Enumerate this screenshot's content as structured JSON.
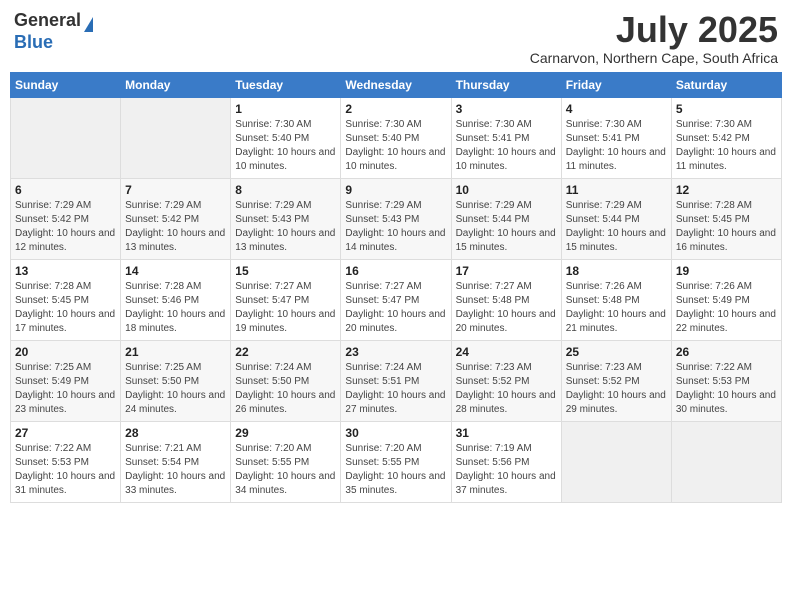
{
  "logo": {
    "general": "General",
    "blue": "Blue"
  },
  "title": "July 2025",
  "subtitle": "Carnarvon, Northern Cape, South Africa",
  "days_of_week": [
    "Sunday",
    "Monday",
    "Tuesday",
    "Wednesday",
    "Thursday",
    "Friday",
    "Saturday"
  ],
  "weeks": [
    [
      {
        "day": "",
        "sunrise": "",
        "sunset": "",
        "daylight": ""
      },
      {
        "day": "",
        "sunrise": "",
        "sunset": "",
        "daylight": ""
      },
      {
        "day": "1",
        "sunrise": "Sunrise: 7:30 AM",
        "sunset": "Sunset: 5:40 PM",
        "daylight": "Daylight: 10 hours and 10 minutes."
      },
      {
        "day": "2",
        "sunrise": "Sunrise: 7:30 AM",
        "sunset": "Sunset: 5:40 PM",
        "daylight": "Daylight: 10 hours and 10 minutes."
      },
      {
        "day": "3",
        "sunrise": "Sunrise: 7:30 AM",
        "sunset": "Sunset: 5:41 PM",
        "daylight": "Daylight: 10 hours and 10 minutes."
      },
      {
        "day": "4",
        "sunrise": "Sunrise: 7:30 AM",
        "sunset": "Sunset: 5:41 PM",
        "daylight": "Daylight: 10 hours and 11 minutes."
      },
      {
        "day": "5",
        "sunrise": "Sunrise: 7:30 AM",
        "sunset": "Sunset: 5:42 PM",
        "daylight": "Daylight: 10 hours and 11 minutes."
      }
    ],
    [
      {
        "day": "6",
        "sunrise": "Sunrise: 7:29 AM",
        "sunset": "Sunset: 5:42 PM",
        "daylight": "Daylight: 10 hours and 12 minutes."
      },
      {
        "day": "7",
        "sunrise": "Sunrise: 7:29 AM",
        "sunset": "Sunset: 5:42 PM",
        "daylight": "Daylight: 10 hours and 13 minutes."
      },
      {
        "day": "8",
        "sunrise": "Sunrise: 7:29 AM",
        "sunset": "Sunset: 5:43 PM",
        "daylight": "Daylight: 10 hours and 13 minutes."
      },
      {
        "day": "9",
        "sunrise": "Sunrise: 7:29 AM",
        "sunset": "Sunset: 5:43 PM",
        "daylight": "Daylight: 10 hours and 14 minutes."
      },
      {
        "day": "10",
        "sunrise": "Sunrise: 7:29 AM",
        "sunset": "Sunset: 5:44 PM",
        "daylight": "Daylight: 10 hours and 15 minutes."
      },
      {
        "day": "11",
        "sunrise": "Sunrise: 7:29 AM",
        "sunset": "Sunset: 5:44 PM",
        "daylight": "Daylight: 10 hours and 15 minutes."
      },
      {
        "day": "12",
        "sunrise": "Sunrise: 7:28 AM",
        "sunset": "Sunset: 5:45 PM",
        "daylight": "Daylight: 10 hours and 16 minutes."
      }
    ],
    [
      {
        "day": "13",
        "sunrise": "Sunrise: 7:28 AM",
        "sunset": "Sunset: 5:45 PM",
        "daylight": "Daylight: 10 hours and 17 minutes."
      },
      {
        "day": "14",
        "sunrise": "Sunrise: 7:28 AM",
        "sunset": "Sunset: 5:46 PM",
        "daylight": "Daylight: 10 hours and 18 minutes."
      },
      {
        "day": "15",
        "sunrise": "Sunrise: 7:27 AM",
        "sunset": "Sunset: 5:47 PM",
        "daylight": "Daylight: 10 hours and 19 minutes."
      },
      {
        "day": "16",
        "sunrise": "Sunrise: 7:27 AM",
        "sunset": "Sunset: 5:47 PM",
        "daylight": "Daylight: 10 hours and 20 minutes."
      },
      {
        "day": "17",
        "sunrise": "Sunrise: 7:27 AM",
        "sunset": "Sunset: 5:48 PM",
        "daylight": "Daylight: 10 hours and 20 minutes."
      },
      {
        "day": "18",
        "sunrise": "Sunrise: 7:26 AM",
        "sunset": "Sunset: 5:48 PM",
        "daylight": "Daylight: 10 hours and 21 minutes."
      },
      {
        "day": "19",
        "sunrise": "Sunrise: 7:26 AM",
        "sunset": "Sunset: 5:49 PM",
        "daylight": "Daylight: 10 hours and 22 minutes."
      }
    ],
    [
      {
        "day": "20",
        "sunrise": "Sunrise: 7:25 AM",
        "sunset": "Sunset: 5:49 PM",
        "daylight": "Daylight: 10 hours and 23 minutes."
      },
      {
        "day": "21",
        "sunrise": "Sunrise: 7:25 AM",
        "sunset": "Sunset: 5:50 PM",
        "daylight": "Daylight: 10 hours and 24 minutes."
      },
      {
        "day": "22",
        "sunrise": "Sunrise: 7:24 AM",
        "sunset": "Sunset: 5:50 PM",
        "daylight": "Daylight: 10 hours and 26 minutes."
      },
      {
        "day": "23",
        "sunrise": "Sunrise: 7:24 AM",
        "sunset": "Sunset: 5:51 PM",
        "daylight": "Daylight: 10 hours and 27 minutes."
      },
      {
        "day": "24",
        "sunrise": "Sunrise: 7:23 AM",
        "sunset": "Sunset: 5:52 PM",
        "daylight": "Daylight: 10 hours and 28 minutes."
      },
      {
        "day": "25",
        "sunrise": "Sunrise: 7:23 AM",
        "sunset": "Sunset: 5:52 PM",
        "daylight": "Daylight: 10 hours and 29 minutes."
      },
      {
        "day": "26",
        "sunrise": "Sunrise: 7:22 AM",
        "sunset": "Sunset: 5:53 PM",
        "daylight": "Daylight: 10 hours and 30 minutes."
      }
    ],
    [
      {
        "day": "27",
        "sunrise": "Sunrise: 7:22 AM",
        "sunset": "Sunset: 5:53 PM",
        "daylight": "Daylight: 10 hours and 31 minutes."
      },
      {
        "day": "28",
        "sunrise": "Sunrise: 7:21 AM",
        "sunset": "Sunset: 5:54 PM",
        "daylight": "Daylight: 10 hours and 33 minutes."
      },
      {
        "day": "29",
        "sunrise": "Sunrise: 7:20 AM",
        "sunset": "Sunset: 5:55 PM",
        "daylight": "Daylight: 10 hours and 34 minutes."
      },
      {
        "day": "30",
        "sunrise": "Sunrise: 7:20 AM",
        "sunset": "Sunset: 5:55 PM",
        "daylight": "Daylight: 10 hours and 35 minutes."
      },
      {
        "day": "31",
        "sunrise": "Sunrise: 7:19 AM",
        "sunset": "Sunset: 5:56 PM",
        "daylight": "Daylight: 10 hours and 37 minutes."
      },
      {
        "day": "",
        "sunrise": "",
        "sunset": "",
        "daylight": ""
      },
      {
        "day": "",
        "sunrise": "",
        "sunset": "",
        "daylight": ""
      }
    ]
  ]
}
